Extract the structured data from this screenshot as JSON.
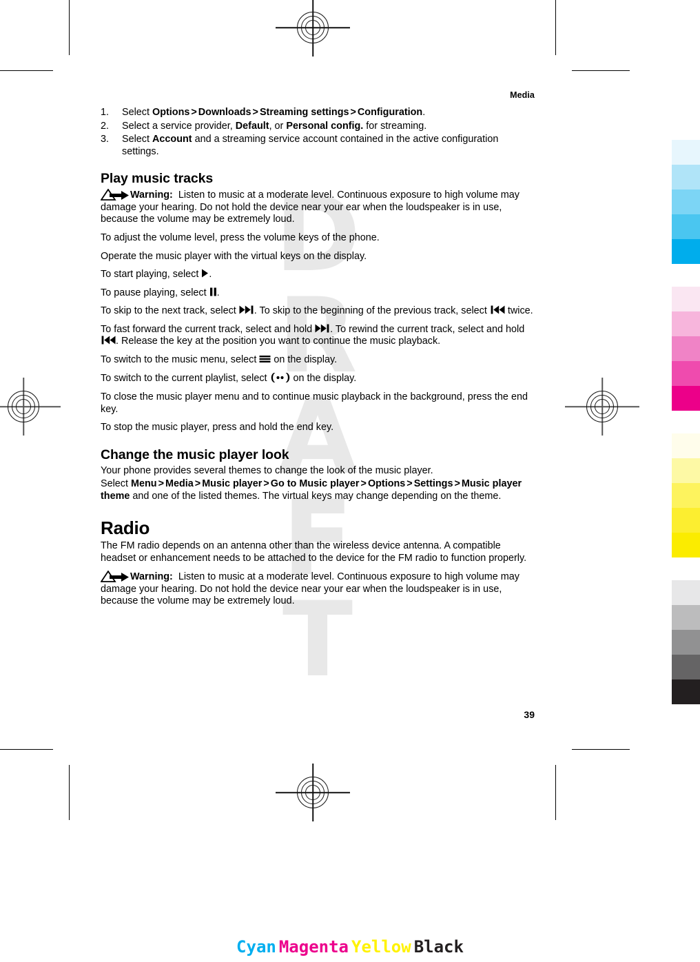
{
  "header": {
    "running_head": "Media"
  },
  "page_number": "39",
  "watermark": "DRAFT",
  "steps": [
    {
      "num": "1.",
      "parts": [
        {
          "t": "Select ",
          "b": false
        },
        {
          "t": "Options",
          "b": true
        },
        {
          "t": ">",
          "b": "gt"
        },
        {
          "t": "Downloads",
          "b": true
        },
        {
          "t": ">",
          "b": "gt"
        },
        {
          "t": "Streaming settings",
          "b": true
        },
        {
          "t": ">",
          "b": "gt"
        },
        {
          "t": "Configuration",
          "b": true
        },
        {
          "t": ".",
          "b": false
        }
      ]
    },
    {
      "num": "2.",
      "parts": [
        {
          "t": "Select a service provider, ",
          "b": false
        },
        {
          "t": "Default",
          "b": true
        },
        {
          "t": ", or ",
          "b": false
        },
        {
          "t": "Personal config.",
          "b": true
        },
        {
          "t": " for streaming.",
          "b": false
        }
      ]
    },
    {
      "num": "3.",
      "parts": [
        {
          "t": "Select ",
          "b": false
        },
        {
          "t": "Account",
          "b": true
        },
        {
          "t": " and a streaming service account contained in the active configuration settings.",
          "b": false
        }
      ]
    }
  ],
  "sections": {
    "play_music_tracks": {
      "heading": "Play music tracks",
      "warning_label": "Warning:",
      "warning_text": "Listen to music at a moderate level. Continuous exposure to high volume may damage your hearing. Do not hold the device near your ear when the loudspeaker is in use, because the volume may be extremely loud.",
      "p_volume": "To adjust the volume level, press the volume keys of the phone.",
      "p_operate": "Operate the music player with the virtual keys on the display.",
      "p_start_a": "To start playing, select ",
      "p_start_b": ".",
      "p_pause_a": "To pause playing, select ",
      "p_pause_b": ".",
      "p_skip_a": "To skip to the next track, select ",
      "p_skip_b": ". To skip to the beginning of the previous track, select ",
      "p_skip_c": " twice.",
      "p_ff_a": "To fast forward the current track, select and hold ",
      "p_ff_b": ". To rewind the current track, select and hold ",
      "p_ff_c": ". Release the key at the position you want to continue the music playback.",
      "p_menu_a": "To switch to the music menu, select ",
      "p_menu_b": " on the display.",
      "p_playlist_a": "To switch to the current playlist, select ",
      "p_playlist_b": " on the display.",
      "p_close": "To close the music player menu and to continue music playback in the background, press the end key.",
      "p_stop": "To stop the music player, press and hold the end key."
    },
    "change_look": {
      "heading": "Change the music player look",
      "p_themes": "Your phone provides several themes to change the look of the music player.",
      "path_intro": "Select ",
      "path_items": [
        "Menu",
        "Media",
        "Music player",
        "Go to Music player",
        "Options",
        "Settings",
        "Music player theme"
      ],
      "path_tail": " and one of the listed themes. The virtual keys may change depending on the theme."
    },
    "radio": {
      "heading": "Radio",
      "p_antenna": "The FM radio depends on an antenna other than the wireless device antenna. A compatible headset or enhancement needs to be attached to the device for the FM radio to function properly.",
      "warning_label": "Warning:",
      "warning_text": "Listen to music at a moderate level. Continuous exposure to high volume may damage your hearing. Do not hold the device near your ear when the loudspeaker is in use, because the volume may be extremely loud."
    }
  },
  "icons": {
    "warning": "warning-triangle-arrow-icon",
    "play": "play-icon",
    "pause": "pause-icon",
    "next": "next-track-icon",
    "previous": "previous-track-icon",
    "menu": "hamburger-menu-icon",
    "playlist": "playlist-icon"
  },
  "cmyk_label": [
    {
      "text": "Cyan",
      "color": "#00AEEF"
    },
    {
      "text": "Magenta",
      "color": "#EC008C"
    },
    {
      "text": "Yellow",
      "color": "#FFF200"
    },
    {
      "text": "Black",
      "color": "#231F20"
    }
  ],
  "color_bars": {
    "cyan": [
      "#E7F6FD",
      "#B0E4F8",
      "#7CD5F5",
      "#4AC6F0",
      "#00ADEC"
    ],
    "magenta": [
      "#FAE6F2",
      "#F7B5DC",
      "#F083C6",
      "#EF4BAE",
      "#EC0089"
    ],
    "yellow": [
      "#FFFDEB",
      "#FDF9A5",
      "#FDF35E",
      "#FCEE30",
      "#FBEC00"
    ],
    "black": [
      "#E7E7E8",
      "#BCBCBD",
      "#919192",
      "#656465",
      "#231F20"
    ]
  }
}
